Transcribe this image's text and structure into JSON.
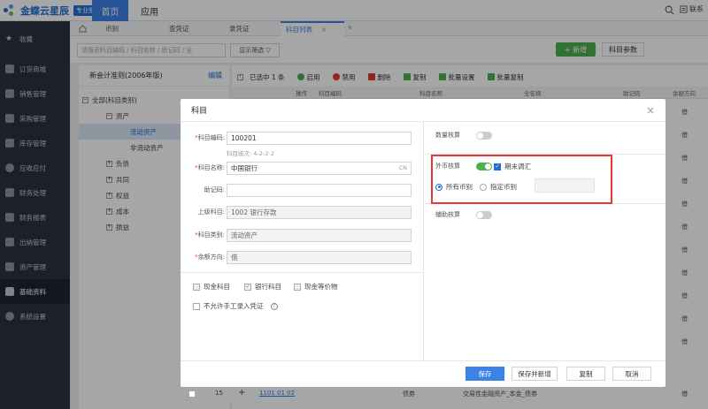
{
  "app": {
    "brand": "金蝶云星辰",
    "badge": "专业版"
  },
  "topnav": {
    "home": "首页",
    "app": "应用",
    "contact": "联系"
  },
  "sidebar": {
    "items": [
      {
        "label": "收藏",
        "icon": "star-icon"
      },
      {
        "label": "订货商城",
        "icon": "store-icon"
      },
      {
        "label": "销售管理",
        "icon": "chart-icon"
      },
      {
        "label": "采购管理",
        "icon": "cart-icon"
      },
      {
        "label": "库存管理",
        "icon": "warehouse-icon"
      },
      {
        "label": "应收应付",
        "icon": "money-icon"
      },
      {
        "label": "财务处理",
        "icon": "ledger-icon"
      },
      {
        "label": "财务报表",
        "icon": "report-icon"
      },
      {
        "label": "出纳管理",
        "icon": "cashier-icon"
      },
      {
        "label": "资产管理",
        "icon": "asset-icon"
      },
      {
        "label": "基础资料",
        "icon": "layers-icon"
      },
      {
        "label": "系统设置",
        "icon": "gear-icon"
      }
    ]
  },
  "tabs": [
    {
      "label": "币别"
    },
    {
      "label": "查凭证"
    },
    {
      "label": "录凭证"
    },
    {
      "label": "科目列表"
    }
  ],
  "toolbar": {
    "search_placeholder": "请搜索科目编码 / 科目名称 / 助记码 / 全",
    "filter": "显示筛选 ▽",
    "new_btn": "+ 新增",
    "param_btn": "科目参数"
  },
  "leftpanel": {
    "title": "新会计准则(2006年版)",
    "edit": "编辑",
    "tree": [
      {
        "label": "全部(科目类别)",
        "indent": 0,
        "box": "−"
      },
      {
        "label": "资产",
        "indent": 1,
        "box": "−"
      },
      {
        "label": "流动资产",
        "indent": 2,
        "box": ""
      },
      {
        "label": "非流动资产",
        "indent": 2,
        "box": ""
      },
      {
        "label": "负债",
        "indent": 1,
        "box": "+"
      },
      {
        "label": "共同",
        "indent": 1,
        "box": "+"
      },
      {
        "label": "权益",
        "indent": 1,
        "box": "+"
      },
      {
        "label": "成本",
        "indent": 1,
        "box": "+"
      },
      {
        "label": "损益",
        "indent": 1,
        "box": "+"
      }
    ]
  },
  "listtoolbar": {
    "selected": "已选中 1 条",
    "enable": "启用",
    "disable": "禁用",
    "delete": "删除",
    "copy": "复制",
    "batch_set": "批量设置",
    "batch_copy": "批量复制"
  },
  "listheader": {
    "op": "操作",
    "code": "科目编码",
    "name": "科目名称",
    "fullname": "全名称",
    "mnemonic": "助记码",
    "direction": "余额方向"
  },
  "list_credit": [
    "借",
    "借",
    "借",
    "借",
    "借",
    "借",
    "借",
    "借",
    "借",
    "借",
    "借"
  ],
  "lastrow": {
    "num": "15",
    "code": "1101 01 02",
    "name": "债券",
    "fullname": "交易性金融资产_本金_债券",
    "direction": "借"
  },
  "modal": {
    "title": "科目",
    "fields": {
      "code_label": "科目编码:",
      "code_value": "100201",
      "code_hint": "科目级次: 4-2-2-2",
      "name_label": "科目名称:",
      "name_value": "中国银行",
      "name_suffix": "CN",
      "mnemonic_label": "助记码:",
      "parent_label": "上级科目:",
      "parent_value": "1002 银行存款",
      "category_label": "科目类别:",
      "category_value": "流动资产",
      "direction_label": "余额方向:",
      "direction_value": "借"
    },
    "checks": {
      "cash": "现金科目",
      "bank": "银行科目",
      "cash_equiv": "现金等价物",
      "no_manual": "不允许手工录入凭证"
    },
    "right": {
      "quantity": "数量核算",
      "foreign": "外币核算",
      "period_adjust": "期末调汇",
      "all_currency": "所有币别",
      "specific_currency": "指定币别",
      "auxiliary": "辅助核算"
    },
    "footer": {
      "save": "保存",
      "save_new": "保存并新增",
      "copy": "复制",
      "cancel": "取消"
    }
  },
  "colors": {
    "accent": "#3b82e6",
    "green": "#4cb050",
    "highlight": "#e53935"
  }
}
